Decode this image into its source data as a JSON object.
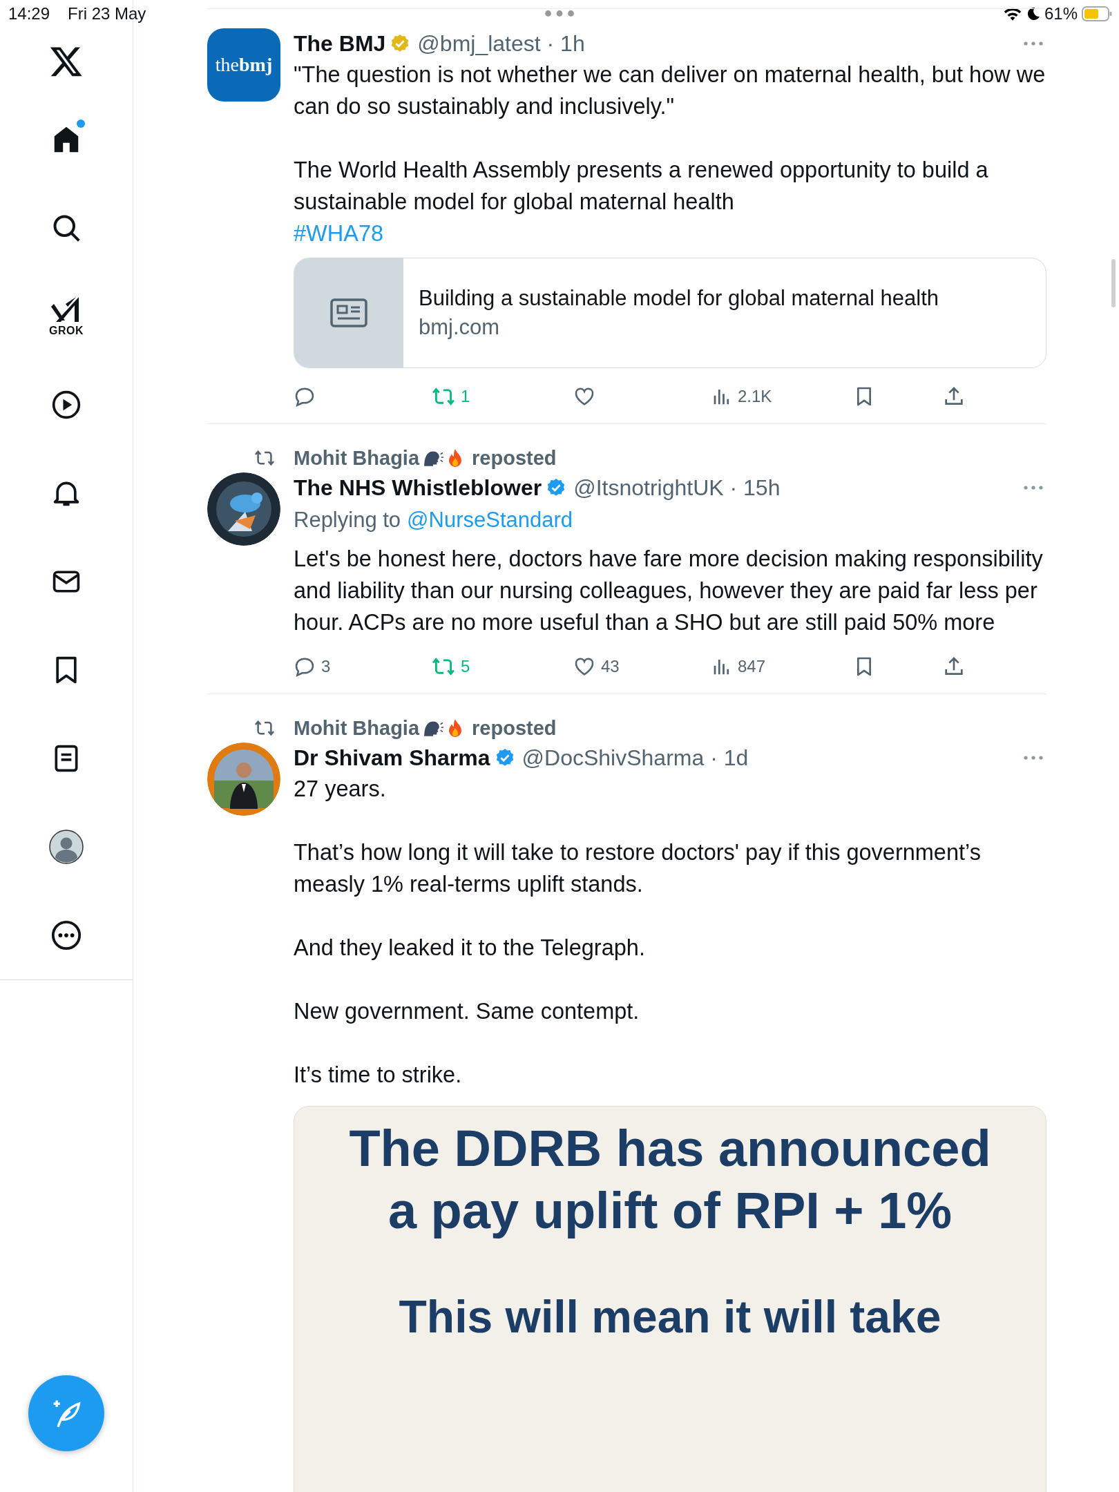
{
  "status_bar": {
    "time": "14:29",
    "date": "Fri 23 May",
    "battery": "61%"
  },
  "sidebar": {
    "items": [
      {
        "kind": "logo",
        "selected": false
      },
      {
        "kind": "home",
        "selected": true,
        "unread": true
      },
      {
        "kind": "search",
        "selected": false
      },
      {
        "kind": "grok",
        "label": "GROK",
        "selected": false
      },
      {
        "kind": "video",
        "selected": false
      },
      {
        "kind": "notifications",
        "selected": false
      },
      {
        "kind": "messages",
        "selected": false
      },
      {
        "kind": "bookmarks",
        "selected": false
      },
      {
        "kind": "lists",
        "selected": false
      },
      {
        "kind": "profile",
        "selected": false
      },
      {
        "kind": "more",
        "selected": false
      }
    ]
  },
  "tweets": [
    {
      "avatar": {
        "kind": "logo",
        "text": "the**bmj**"
      },
      "name": "The BMJ",
      "badge": {
        "color": "#e2b719"
      },
      "meta": "@bmj_latest · 1h",
      "paragraphs": [
        "\"The question is not whether we can deliver on maternal health, but how we can do so sustainably and inclusively.\"",
        "The World Health Assembly presents a renewed opportunity to build a sustainable model for global maternal health"
      ],
      "hashtag": "#WHA78",
      "link_card": {
        "title": "Building a sustainable model for global maternal health",
        "domain": "bmj.com"
      },
      "actions": [
        {
          "kind": "reply",
          "active": false
        },
        {
          "kind": "repost",
          "count": "1",
          "active": true
        },
        {
          "kind": "like",
          "active": false
        },
        {
          "kind": "views",
          "count": "2.1K",
          "active": false
        },
        {
          "kind": "bookmark",
          "active": false
        },
        {
          "kind": "share",
          "active": false
        }
      ]
    },
    {
      "reposted_by": {
        "name": "Mohit Bhagia",
        "label": "reposted"
      },
      "avatar": {
        "kind": "picture"
      },
      "name": "The NHS Whistleblower",
      "badge": {
        "color": "#1d9bf0"
      },
      "meta": "@ItsnotrightUK · 15h",
      "replying_to": {
        "label": "Replying to",
        "handle": "@NurseStandard"
      },
      "paragraphs": [
        "Let's be honest here, doctors have fare more decision making responsibility and liability than our nursing colleagues, however they are paid far less per hour.  ACPs are no more useful than a SHO but are still paid 50% more"
      ],
      "actions": [
        {
          "kind": "reply",
          "count": "3",
          "active": false
        },
        {
          "kind": "repost",
          "count": "5",
          "active": true
        },
        {
          "kind": "like",
          "count": "43",
          "active": false
        },
        {
          "kind": "views",
          "count": "847",
          "active": false
        },
        {
          "kind": "bookmark",
          "active": false
        },
        {
          "kind": "share",
          "active": false
        }
      ]
    },
    {
      "reposted_by": {
        "name": "Mohit Bhagia",
        "label": "reposted"
      },
      "avatar": {
        "kind": "picture"
      },
      "name": "Dr Shivam Sharma",
      "badge": {
        "color": "#1d9bf0"
      },
      "meta": "@DocShivSharma · 1d",
      "paragraphs": [
        "27 years.",
        "That’s how long it will take to restore doctors' pay if this government’s measly 1% real-terms uplift stands.",
        "And they leaked it to the Telegraph.",
        "New government. Same contempt.",
        "It’s time to strike."
      ],
      "image": {
        "headline": [
          "The DDRB has announced",
          "a pay uplift of RPI + 1%"
        ],
        "subline": "This will mean it will take"
      }
    }
  ]
}
